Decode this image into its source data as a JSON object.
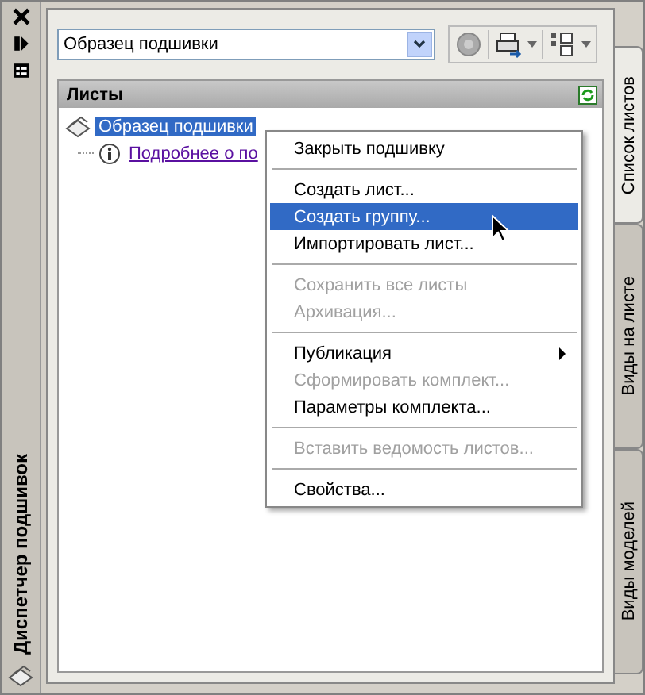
{
  "palette": {
    "title": "Диспетчер подшивок"
  },
  "side_tabs": [
    {
      "label": "Список листов",
      "selected": true
    },
    {
      "label": "Виды на листе",
      "selected": false
    },
    {
      "label": "Виды моделей",
      "selected": false
    }
  ],
  "sheet_set_dropdown": {
    "value": "Образец подшивки"
  },
  "panel": {
    "title": "Листы"
  },
  "tree": [
    {
      "label": "Образец подшивки",
      "selected": true,
      "kind": "sheetset",
      "children": [
        {
          "label": "Подробнее о по",
          "selected": false,
          "kind": "link"
        }
      ]
    }
  ],
  "context_menu": [
    {
      "kind": "item",
      "label": "Закрыть подшивку",
      "disabled": false,
      "selected": false,
      "submenu": false
    },
    {
      "kind": "separator"
    },
    {
      "kind": "item",
      "label": "Создать лист...",
      "disabled": false,
      "selected": false,
      "submenu": false
    },
    {
      "kind": "item",
      "label": "Создать группу...",
      "disabled": false,
      "selected": true,
      "submenu": false
    },
    {
      "kind": "item",
      "label": "Импортировать лист...",
      "disabled": false,
      "selected": false,
      "submenu": false
    },
    {
      "kind": "separator"
    },
    {
      "kind": "item",
      "label": "Сохранить все листы",
      "disabled": true,
      "selected": false,
      "submenu": false
    },
    {
      "kind": "item",
      "label": "Архивация...",
      "disabled": true,
      "selected": false,
      "submenu": false
    },
    {
      "kind": "separator"
    },
    {
      "kind": "item",
      "label": "Публикация",
      "disabled": false,
      "selected": false,
      "submenu": true
    },
    {
      "kind": "item",
      "label": "Сформировать комплект...",
      "disabled": true,
      "selected": false,
      "submenu": false
    },
    {
      "kind": "item",
      "label": "Параметры комплекта...",
      "disabled": false,
      "selected": false,
      "submenu": false
    },
    {
      "kind": "separator"
    },
    {
      "kind": "item",
      "label": "Вставить ведомость листов...",
      "disabled": true,
      "selected": false,
      "submenu": false
    },
    {
      "kind": "separator"
    },
    {
      "kind": "item",
      "label": "Свойства...",
      "disabled": false,
      "selected": false,
      "submenu": false
    }
  ]
}
